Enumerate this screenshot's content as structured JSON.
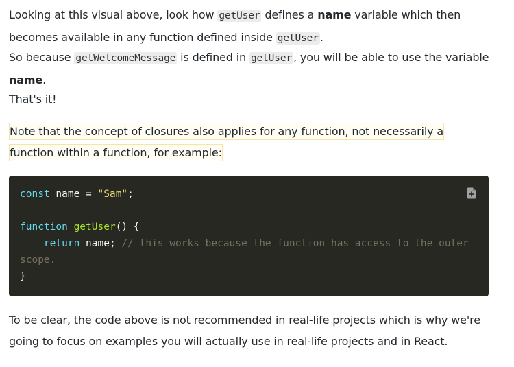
{
  "intro": {
    "p1_a": "Looking at this visual above, look how ",
    "p1_code1": "getUser",
    "p1_b": " defines a ",
    "p1_bold": "name",
    "p1_c": " variable which then becomes available in any function defined inside ",
    "p1_code2": "getUser",
    "p1_d": ".",
    "p2_a": "So because ",
    "p2_code1": "getWelcomeMessage",
    "p2_b": " is defined in ",
    "p2_code2": "getUser",
    "p2_c": ", you will be able to use the variable ",
    "p2_bold": "name",
    "p2_d": ".",
    "p3": "That's it!"
  },
  "note": {
    "text": "Note that the concept of closures also applies for any function, not necessarily a function within a function, for example:"
  },
  "code_block": {
    "line1_kw": "const",
    "line1_rest": " name = ",
    "line1_str": "\"Sam\"",
    "line1_end": ";",
    "line3_kw": "function",
    "line3_fn": "getUser",
    "line3_rest": "() {",
    "line4_indent": "    ",
    "line4_kw": "return",
    "line4_rest": " name; ",
    "line4_comment": "// this works because the function has access to the outer scope.",
    "line5": "}",
    "copy_icon": "copy-file-icon",
    "colors": {
      "background": "#272822",
      "keyword": "#66d9ef",
      "function": "#a6e22e",
      "string": "#e6db74",
      "comment": "#75715e"
    }
  },
  "outro": {
    "text": "To be clear, the code above is not recommended in real-life projects which is why we're going to focus on examples you will actually use in real-life projects and in React."
  }
}
